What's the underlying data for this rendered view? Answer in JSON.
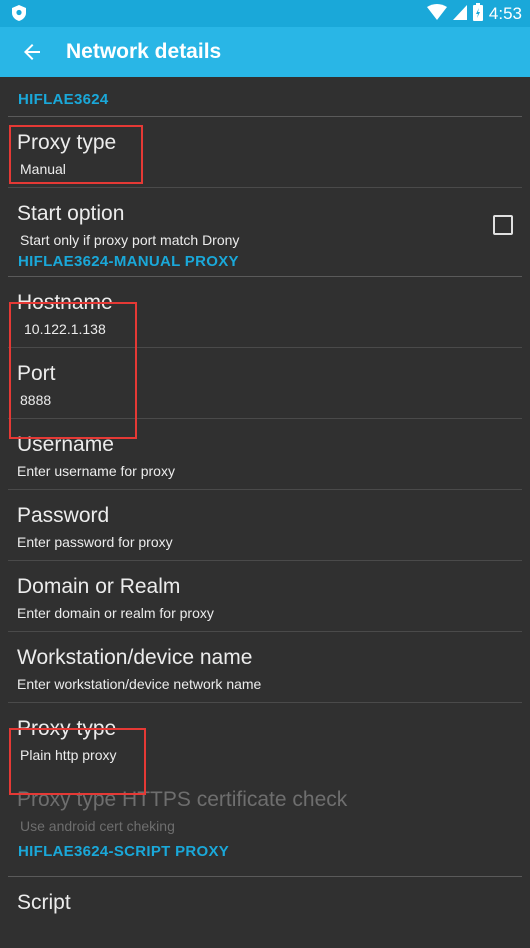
{
  "status_bar": {
    "time": "4:53"
  },
  "app_bar": {
    "title": "Network details"
  },
  "sections": {
    "network": "HIFLAE3624",
    "manual_proxy": "HIFLAE3624-MANUAL PROXY",
    "script_proxy": "HIFLAE3624-SCRIPT PROXY"
  },
  "items": {
    "proxy_type": {
      "title": "Proxy type",
      "summary": "Manual"
    },
    "start_option": {
      "title": "Start option",
      "summary": "Start only if proxy port match Drony",
      "checked": false
    },
    "hostname": {
      "title": "Hostname",
      "summary": "10.122.1.138"
    },
    "port": {
      "title": "Port",
      "summary": "8888"
    },
    "username": {
      "title": "Username",
      "summary": "Enter username for proxy"
    },
    "password": {
      "title": "Password",
      "summary": "Enter password for proxy"
    },
    "domain": {
      "title": "Domain or Realm",
      "summary": "Enter domain or realm for proxy"
    },
    "workstation": {
      "title": "Workstation/device name",
      "summary": "Enter workstation/device network name"
    },
    "proxy_type_2": {
      "title": "Proxy type",
      "summary": "Plain http proxy"
    },
    "https_check": {
      "title": "Proxy type HTTPS certificate check",
      "summary": "Use android cert cheking"
    },
    "script": {
      "title": "Script"
    }
  },
  "colors": {
    "accent": "#29b6e6",
    "status_bar": "#1aa8d9",
    "background": "#303030",
    "highlight": "#e53935"
  }
}
